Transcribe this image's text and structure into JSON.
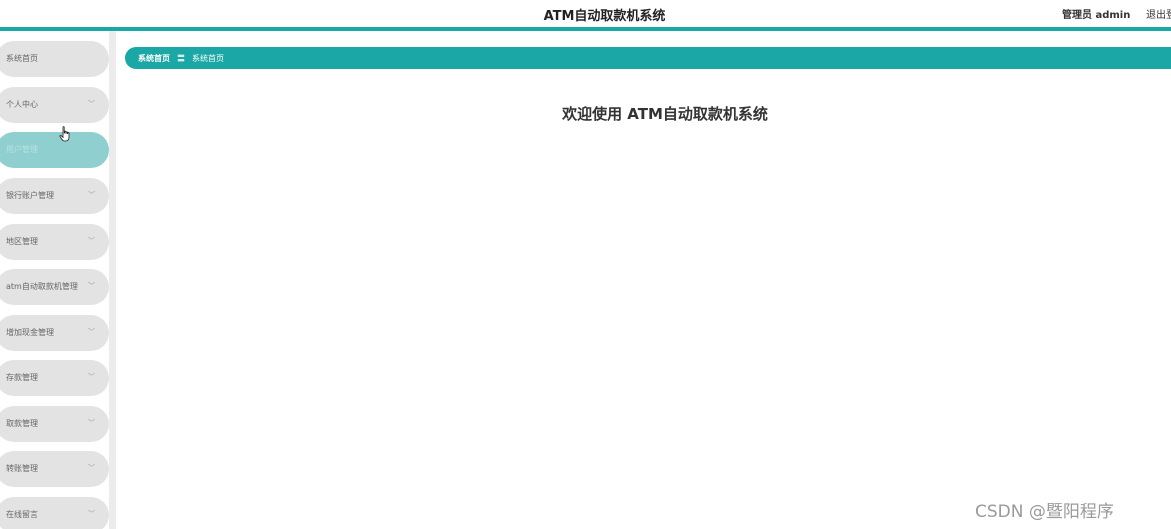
{
  "header": {
    "title": "ATM自动取款机系统",
    "user": "管理员 admin",
    "logout": "退出登录"
  },
  "sidebar": {
    "items": [
      {
        "label": "系统首页",
        "has_chevron": false,
        "active": false
      },
      {
        "label": "个人中心",
        "has_chevron": true,
        "active": false
      },
      {
        "label": "用户管理",
        "has_chevron": true,
        "active": true
      },
      {
        "label": "银行账户管理",
        "has_chevron": true,
        "active": false
      },
      {
        "label": "地区管理",
        "has_chevron": true,
        "active": false
      },
      {
        "label": "atm自动取款机管理",
        "has_chevron": true,
        "active": false
      },
      {
        "label": "增加现金管理",
        "has_chevron": true,
        "active": false
      },
      {
        "label": "存款管理",
        "has_chevron": true,
        "active": false
      },
      {
        "label": "取款管理",
        "has_chevron": true,
        "active": false
      },
      {
        "label": "转账管理",
        "has_chevron": true,
        "active": false
      },
      {
        "label": "在线留言",
        "has_chevron": true,
        "active": false
      }
    ]
  },
  "breadcrumb": {
    "home": "系统首页",
    "separator": "〓",
    "current": "系统首页"
  },
  "main": {
    "welcome": "欢迎使用 ATM自动取款机系统"
  },
  "watermark": "CSDN @暨阳程序",
  "colors": {
    "accent": "#1aa7a5",
    "menu_bg": "#e3e3e3",
    "menu_active": "#8fcfcf"
  }
}
